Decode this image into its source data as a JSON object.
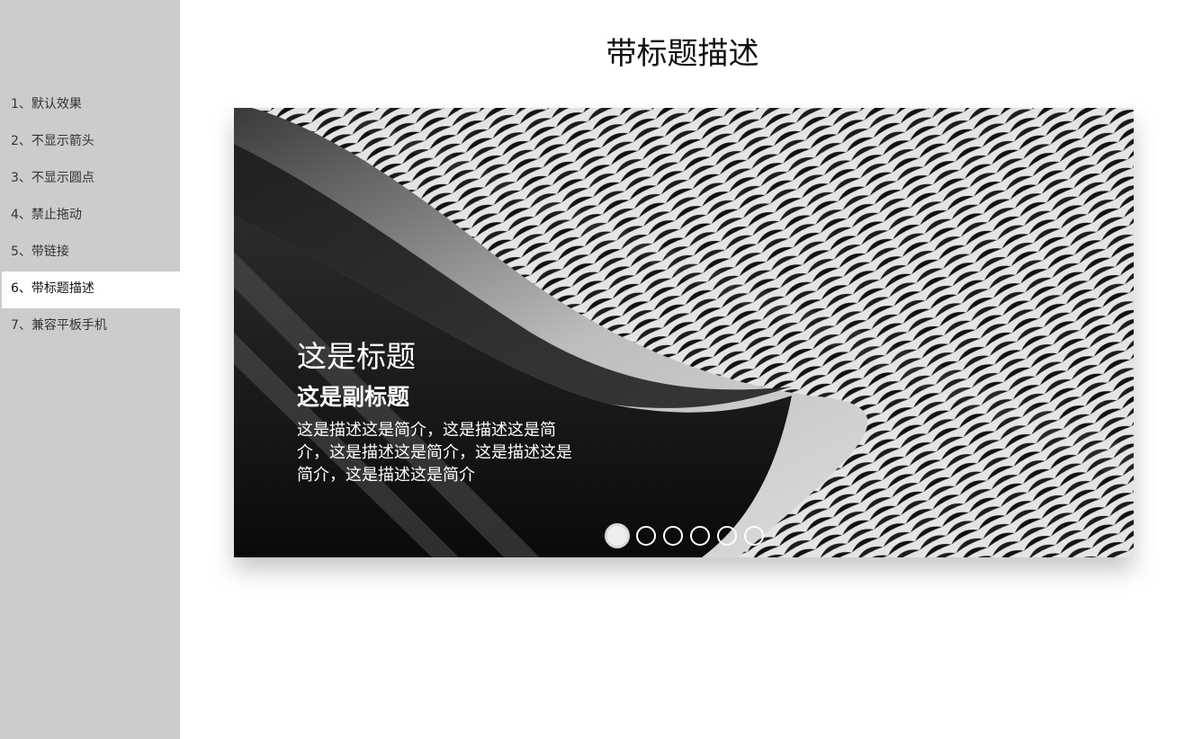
{
  "sidebar": {
    "items": [
      {
        "label": "1、默认效果"
      },
      {
        "label": "2、不显示箭头"
      },
      {
        "label": "3、不显示圆点"
      },
      {
        "label": "4、禁止拖动"
      },
      {
        "label": "5、带链接"
      },
      {
        "label": "6、带标题描述"
      },
      {
        "label": "7、兼容平板手机"
      }
    ],
    "active_index": 5
  },
  "page": {
    "title": "带标题描述"
  },
  "slider": {
    "slide_image": "abstract-woven-architecture-photo",
    "caption": {
      "title": "这是标题",
      "subtitle": "这是副标题",
      "description": "这是描述这是简介，这是描述这是简介，这是描述这是简介，这是描述这是简介，这是描述这是简介"
    },
    "dots": {
      "count": 6,
      "active_index": 0
    }
  },
  "colors": {
    "sidebar_bg": "#cccccc",
    "active_item_bg": "#ffffff",
    "caption_text": "#ffffff"
  }
}
